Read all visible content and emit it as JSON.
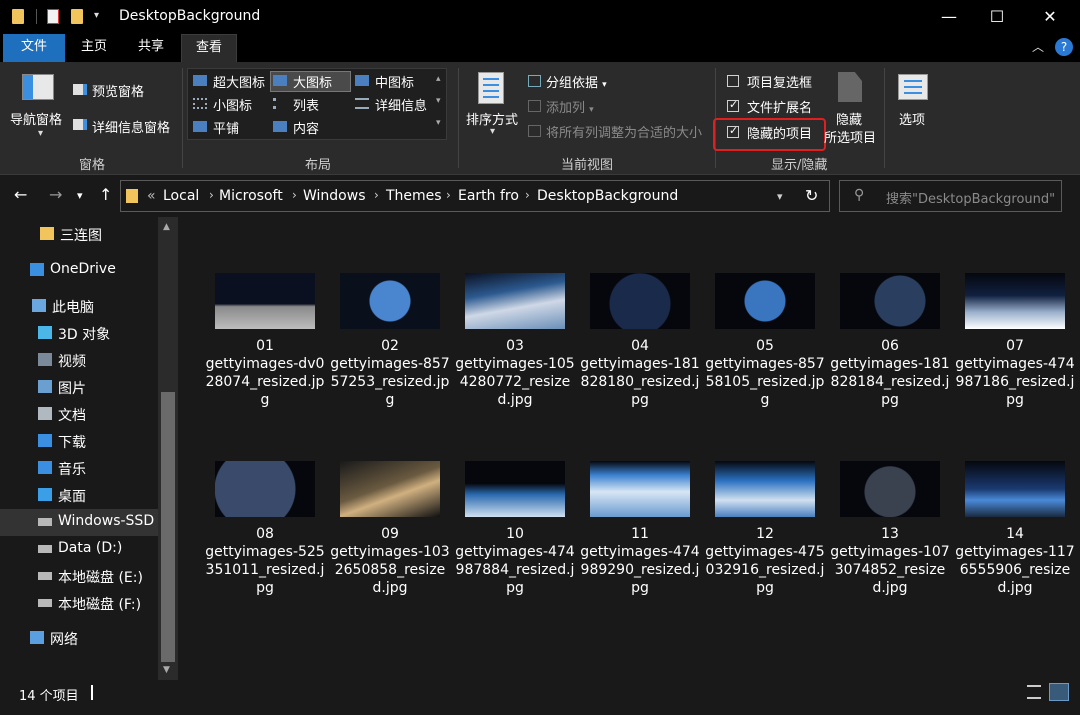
{
  "window": {
    "title": "DesktopBackground",
    "minimize": "—",
    "maximize": "☐",
    "close": "✕"
  },
  "ribbon_tabs": [
    "文件",
    "主页",
    "共享",
    "查看"
  ],
  "ribbon": {
    "panes": {
      "nav_pane": "导航窗格",
      "preview_pane": "预览窗格",
      "details_pane": "详细信息窗格",
      "group": "窗格"
    },
    "layout": {
      "items": [
        "超大图标",
        "大图标",
        "中图标",
        "小图标",
        "列表",
        "详细信息",
        "平铺",
        "内容"
      ],
      "selected": "大图标",
      "group": "布局"
    },
    "current_view": {
      "sort": "排序方式",
      "group_by": "分组依据",
      "add_column": "添加列",
      "fit_columns": "将所有列调整为合适的大小",
      "group": "当前视图"
    },
    "show_hide": {
      "item_checkboxes": "项目复选框",
      "item_checkboxes_on": false,
      "file_ext": "文件扩展名",
      "file_ext_on": true,
      "hidden_items": "隐藏的项目",
      "hidden_items_on": true,
      "hide_selected_1": "隐藏",
      "hide_selected_2": "所选项目",
      "group": "显示/隐藏"
    },
    "options": "选项"
  },
  "address": {
    "crumbs": [
      "«",
      "Local",
      "Microsoft",
      "Windows",
      "Themes",
      "Earth fro",
      "DesktopBackground"
    ],
    "search_placeholder": "搜索\"DesktopBackground\""
  },
  "sidebar": [
    {
      "label": "三连图",
      "icon": "folder-icon"
    },
    {
      "label": "OneDrive",
      "icon": "cloud-icon"
    },
    {
      "label": "此电脑",
      "icon": "pc-icon"
    },
    {
      "label": "3D 对象",
      "icon": "cube-icon"
    },
    {
      "label": "视频",
      "icon": "video-icon"
    },
    {
      "label": "图片",
      "icon": "picture-icon"
    },
    {
      "label": "文档",
      "icon": "document-icon"
    },
    {
      "label": "下载",
      "icon": "download-icon"
    },
    {
      "label": "音乐",
      "icon": "music-icon"
    },
    {
      "label": "桌面",
      "icon": "desktop-icon"
    },
    {
      "label": "Windows-SSD (",
      "icon": "drive-icon"
    },
    {
      "label": "Data (D:)",
      "icon": "drive-icon"
    },
    {
      "label": "本地磁盘 (E:)",
      "icon": "drive-icon"
    },
    {
      "label": "本地磁盘 (F:)",
      "icon": "drive-icon"
    },
    {
      "label": "网络",
      "icon": "network-icon"
    }
  ],
  "files": [
    {
      "num": "01",
      "name": "gettyimages-dv028074_resized.jpg"
    },
    {
      "num": "02",
      "name": "gettyimages-85757253_resized.jpg"
    },
    {
      "num": "03",
      "name": "gettyimages-1054280772_resized.jpg"
    },
    {
      "num": "04",
      "name": "gettyimages-181828180_resized.jpg"
    },
    {
      "num": "05",
      "name": "gettyimages-85758105_resized.jpg"
    },
    {
      "num": "06",
      "name": "gettyimages-181828184_resized.jpg"
    },
    {
      "num": "07",
      "name": "gettyimages-474987186_resized.jpg"
    },
    {
      "num": "08",
      "name": "gettyimages-525351011_resized.jpg"
    },
    {
      "num": "09",
      "name": "gettyimages-1032650858_resized.jpg"
    },
    {
      "num": "10",
      "name": "gettyimages-474987884_resized.jpg"
    },
    {
      "num": "11",
      "name": "gettyimages-474989290_resized.jpg"
    },
    {
      "num": "12",
      "name": "gettyimages-475032916_resized.jpg"
    },
    {
      "num": "13",
      "name": "gettyimages-1073074852_resized.jpg"
    },
    {
      "num": "14",
      "name": "gettyimages-1176555906_resized.jpg"
    }
  ],
  "status": {
    "count": "14 个项目"
  },
  "colors": {
    "accent": "#1f6fbf",
    "highlight": "#e02020"
  }
}
